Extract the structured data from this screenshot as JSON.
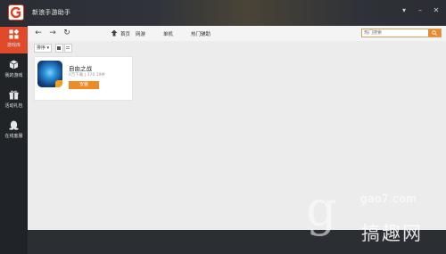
{
  "app": {
    "title": "新浪手游助手"
  },
  "window_controls": {
    "menu": "▾",
    "minimize": "–",
    "close": "✕"
  },
  "sidebar": {
    "items": [
      {
        "label": "游戏库",
        "icon": "grid-plus-icon",
        "active": true
      },
      {
        "label": "我的游戏",
        "icon": "cube-icon",
        "active": false
      },
      {
        "label": "活动礼包",
        "icon": "gift-icon",
        "active": false
      },
      {
        "label": "在线客服",
        "icon": "chat-penguin-icon",
        "active": false
      }
    ]
  },
  "toolbar": {
    "back": "←",
    "forward": "→",
    "refresh": "↻",
    "tabs": [
      "首页",
      "网游",
      "单机",
      "热门辅助"
    ],
    "search_placeholder": "热门搜索"
  },
  "content": {
    "sort_label": "排序 ▾",
    "card": {
      "name": "自由之战",
      "stats": "0万下载 | 170.19M",
      "install_label": "安装"
    }
  },
  "watermark": {
    "glyph": "g",
    "url": "gao7.com",
    "text": "搞趣网"
  },
  "colors": {
    "accent": "#e0492a",
    "install": "#f08a24",
    "sidebar": "#202327",
    "titlebar": "#2a2d33"
  }
}
